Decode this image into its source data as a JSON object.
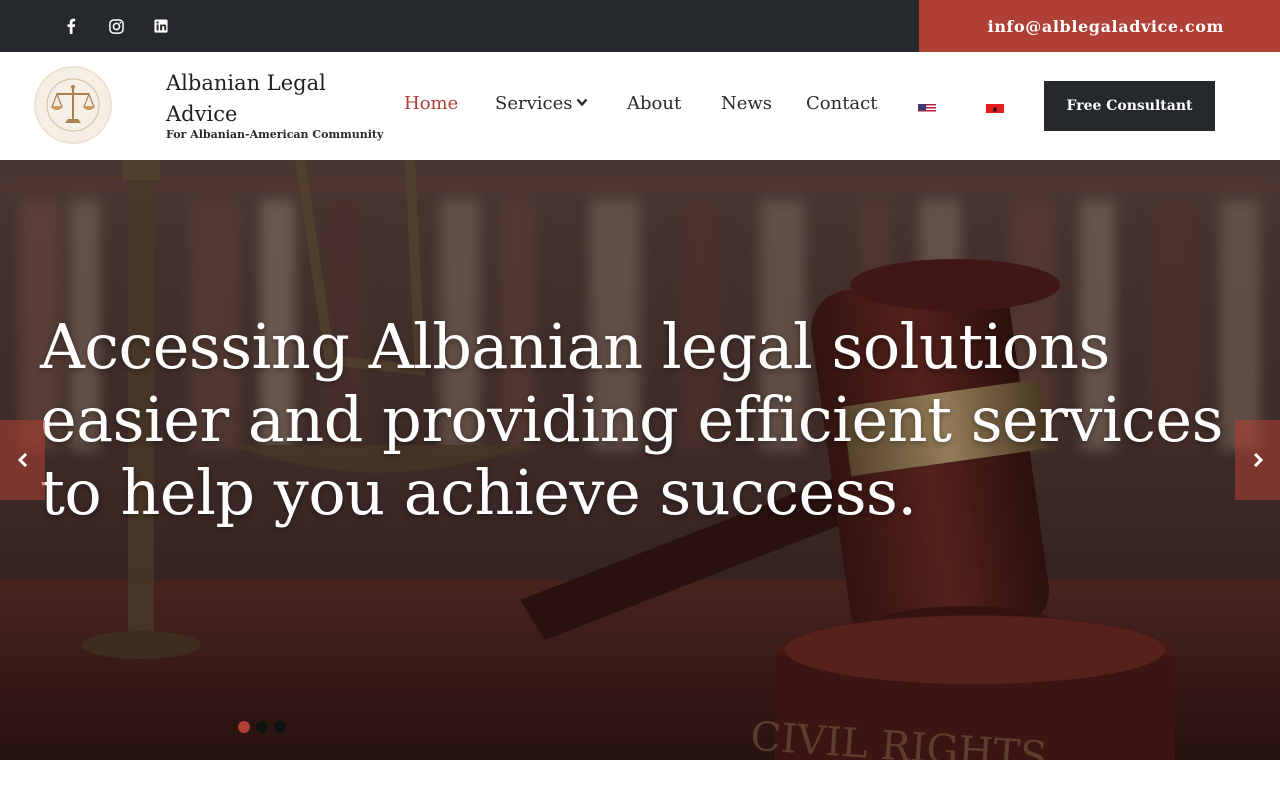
{
  "topbar": {
    "social": [
      {
        "name": "facebook-icon"
      },
      {
        "name": "instagram-icon"
      },
      {
        "name": "linkedin-icon"
      }
    ],
    "email": "info@alblegaladvice.com",
    "colors": {
      "bar": "#25282c",
      "accent": "#b03f35"
    }
  },
  "brand": {
    "title": "Albanian Legal Advice",
    "tagline": "For Albanian-American Community",
    "logo_icon": "scales-of-justice-icon"
  },
  "nav": {
    "items": [
      {
        "label": "Home",
        "active": true
      },
      {
        "label": "Services",
        "has_dropdown": true
      },
      {
        "label": "About"
      },
      {
        "label": "News"
      },
      {
        "label": "Contact"
      }
    ],
    "languages": [
      "us-flag-icon",
      "albania-flag-icon"
    ],
    "cta_label": "Free Consultant"
  },
  "hero": {
    "heading": "Accessing Albanian legal solutions easier and providing efficient services to help you achieve success.",
    "background_icon": "gavel-and-scales-photo",
    "slides": 3,
    "active_slide": 0,
    "prev_icon": "chevron-left-icon",
    "next_icon": "chevron-right-icon"
  }
}
